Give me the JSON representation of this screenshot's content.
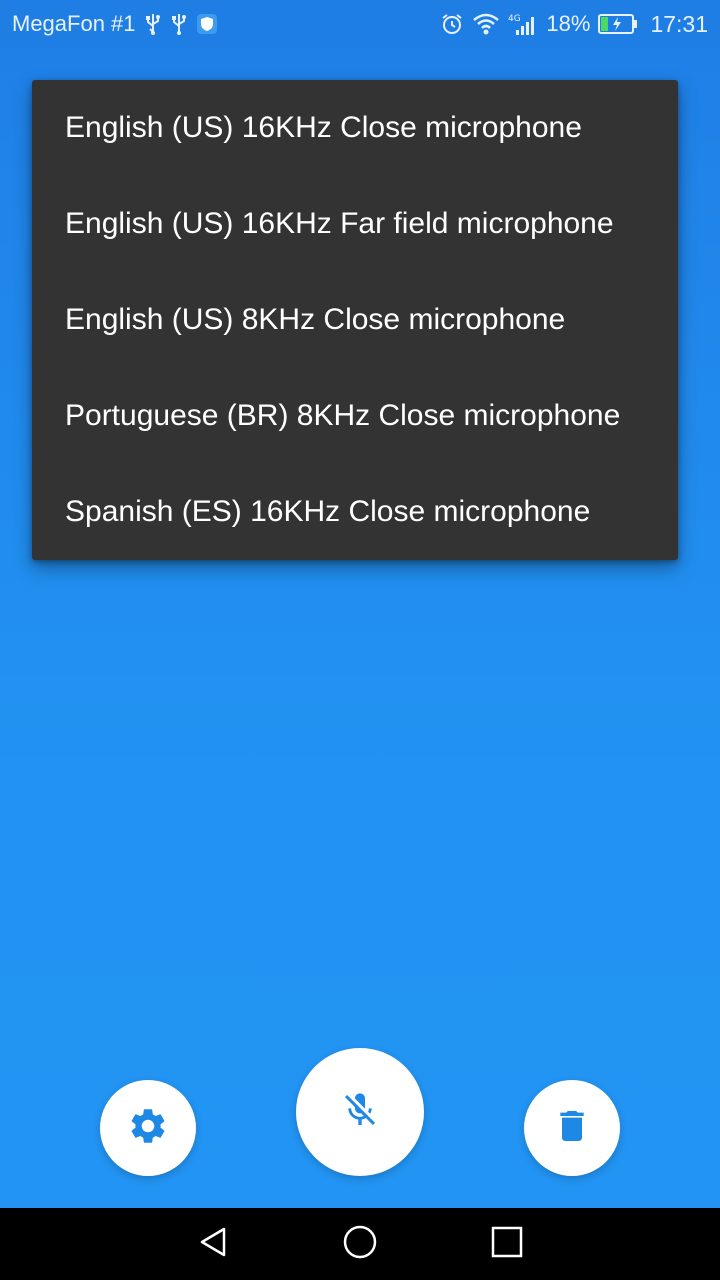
{
  "status_bar": {
    "carrier": "MegaFon #1",
    "network": "4G",
    "battery": "18%",
    "time": "17:31",
    "icons": [
      "usb-icon",
      "usb-icon",
      "shield-icon",
      "alarm-icon",
      "wifi-icon",
      "signal-icon",
      "battery-charging-icon"
    ]
  },
  "menu": {
    "items": [
      {
        "label": "English (US) 16KHz Close microphone"
      },
      {
        "label": "English (US) 16KHz Far field microphone"
      },
      {
        "label": "English (US) 8KHz Close microphone"
      },
      {
        "label": "Portuguese (BR) 8KHz Close microphone"
      },
      {
        "label": "Spanish (ES) 16KHz Close microphone"
      }
    ]
  },
  "controls": {
    "settings_icon": "gear-icon",
    "mic_icon": "mic-off-icon",
    "delete_icon": "trash-icon",
    "icon_color": "#1e88e5"
  },
  "nav_bar": {
    "icons": [
      "back-icon",
      "home-icon",
      "recents-icon"
    ]
  }
}
